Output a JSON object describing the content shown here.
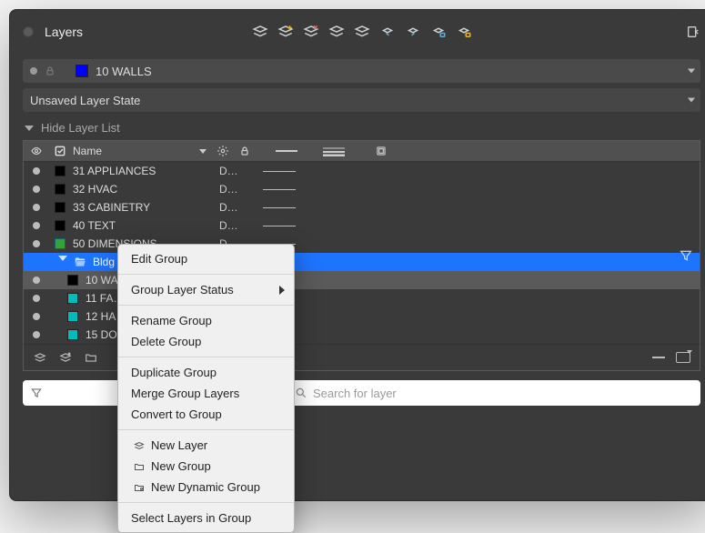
{
  "window": {
    "title": "Layers"
  },
  "toolbar_icons": [
    "layers-stack-icon",
    "layers-stack-plus-icon",
    "layers-stack-x-icon",
    "layers-stack-check-icon",
    "layers-stack-move-icon",
    "layers-stack-arrow-left-icon",
    "layers-stack-arrow-right-icon",
    "layers-stack-lock-icon",
    "layers-stack-unlock-icon"
  ],
  "current_layer": {
    "name": "10 WALLS",
    "color": "#0000ff"
  },
  "layer_state": "Unsaved Layer State",
  "hide_layer_list_label": "Hide Layer List",
  "columns": {
    "name": "Name"
  },
  "layers": [
    {
      "name": "31 APPLIANCES",
      "color": "#000000",
      "d": "D…"
    },
    {
      "name": "32 HVAC",
      "color": "#000000",
      "d": "D…"
    },
    {
      "name": "33 CABINETRY",
      "color": "#000000",
      "d": "D…"
    },
    {
      "name": "40 TEXT",
      "color": "#000000",
      "d": "D…"
    },
    {
      "name": "50 DIMENSIONS",
      "color": "#cc0000",
      "d": "D…"
    }
  ],
  "group": {
    "name": "Bldg …",
    "folder_color": "#3a87ff"
  },
  "children": [
    {
      "name": "10 WA…",
      "color": "#000000",
      "d": ""
    },
    {
      "name": "11 FA…",
      "color": "#00bcbc",
      "d": ""
    },
    {
      "name": "12 HA…",
      "color": "#00bcbc",
      "d": ""
    },
    {
      "name": "15 DO…",
      "color": "#00bcbc",
      "d": ""
    }
  ],
  "search": {
    "placeholder": "Search for layer"
  },
  "context_menu": {
    "edit_group": "Edit Group",
    "group_layer_status": "Group Layer Status",
    "rename_group": "Rename Group",
    "delete_group": "Delete Group",
    "duplicate_group": "Duplicate Group",
    "merge_group_layers": "Merge Group Layers",
    "convert_to_group": "Convert to Group",
    "new_layer": "New Layer",
    "new_group": "New Group",
    "new_dynamic_group": "New Dynamic Group",
    "select_layers_in_group": "Select Layers in Group"
  }
}
